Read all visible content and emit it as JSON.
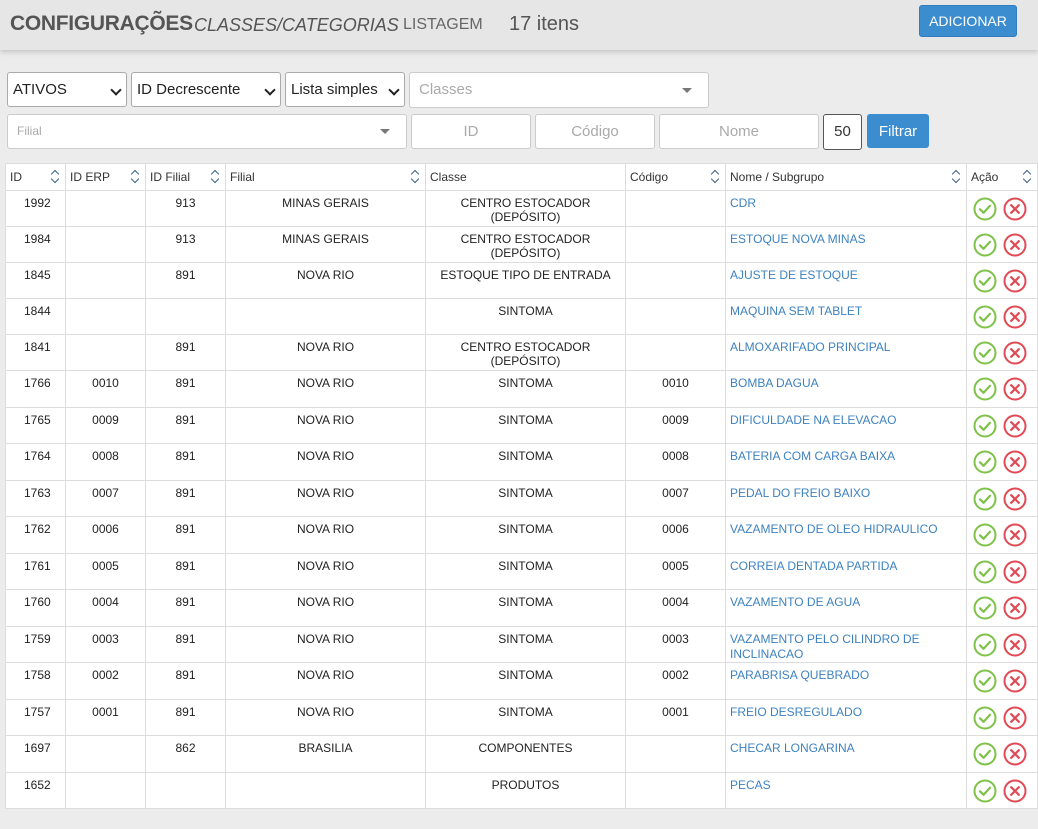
{
  "header": {
    "title": "CONFIGURAÇÕES",
    "subtitle": "CLASSES/CATEGORIAS",
    "view": "LISTAGEM",
    "count": "17 itens",
    "add_label": "ADICIONAR"
  },
  "filters": {
    "status": "ATIVOS",
    "order": "ID Decrescente",
    "mode": "Lista simples",
    "classes_placeholder": "Classes",
    "filial_placeholder": "Filial",
    "id_placeholder": "ID",
    "codigo_placeholder": "Código",
    "nome_placeholder": "Nome",
    "limit": "50",
    "filter_label": "Filtrar"
  },
  "table": {
    "columns": [
      "ID",
      "ID ERP",
      "ID Filial",
      "Filial",
      "Classe",
      "Código",
      "Nome / Subgrupo",
      "Ação"
    ],
    "rows": [
      {
        "id": "1992",
        "id_erp": "",
        "id_filial": "913",
        "filial": "MINAS GERAIS",
        "classe": "CENTRO ESTOCADOR (DEPÓSITO)",
        "codigo": "",
        "nome": "CDR"
      },
      {
        "id": "1984",
        "id_erp": "",
        "id_filial": "913",
        "filial": "MINAS GERAIS",
        "classe": "CENTRO ESTOCADOR (DEPÓSITO)",
        "codigo": "",
        "nome": "ESTOQUE NOVA MINAS"
      },
      {
        "id": "1845",
        "id_erp": "",
        "id_filial": "891",
        "filial": "NOVA RIO",
        "classe": "ESTOQUE TIPO DE ENTRADA",
        "codigo": "",
        "nome": "AJUSTE DE ESTOQUE"
      },
      {
        "id": "1844",
        "id_erp": "",
        "id_filial": "",
        "filial": "",
        "classe": "SINTOMA",
        "codigo": "",
        "nome": "MAQUINA SEM TABLET"
      },
      {
        "id": "1841",
        "id_erp": "",
        "id_filial": "891",
        "filial": "NOVA RIO",
        "classe": "CENTRO ESTOCADOR (DEPÓSITO)",
        "codigo": "",
        "nome": "ALMOXARIFADO PRINCIPAL"
      },
      {
        "id": "1766",
        "id_erp": "0010",
        "id_filial": "891",
        "filial": "NOVA RIO",
        "classe": "SINTOMA",
        "codigo": "0010",
        "nome": "BOMBA DAGUA"
      },
      {
        "id": "1765",
        "id_erp": "0009",
        "id_filial": "891",
        "filial": "NOVA RIO",
        "classe": "SINTOMA",
        "codigo": "0009",
        "nome": "DIFICULDADE NA ELEVACAO"
      },
      {
        "id": "1764",
        "id_erp": "0008",
        "id_filial": "891",
        "filial": "NOVA RIO",
        "classe": "SINTOMA",
        "codigo": "0008",
        "nome": "BATERIA COM CARGA BAIXA"
      },
      {
        "id": "1763",
        "id_erp": "0007",
        "id_filial": "891",
        "filial": "NOVA RIO",
        "classe": "SINTOMA",
        "codigo": "0007",
        "nome": "PEDAL DO FREIO BAIXO"
      },
      {
        "id": "1762",
        "id_erp": "0006",
        "id_filial": "891",
        "filial": "NOVA RIO",
        "classe": "SINTOMA",
        "codigo": "0006",
        "nome": "VAZAMENTO DE OLEO HIDRAULICO"
      },
      {
        "id": "1761",
        "id_erp": "0005",
        "id_filial": "891",
        "filial": "NOVA RIO",
        "classe": "SINTOMA",
        "codigo": "0005",
        "nome": "CORREIA DENTADA PARTIDA"
      },
      {
        "id": "1760",
        "id_erp": "0004",
        "id_filial": "891",
        "filial": "NOVA RIO",
        "classe": "SINTOMA",
        "codigo": "0004",
        "nome": "VAZAMENTO DE AGUA"
      },
      {
        "id": "1759",
        "id_erp": "0003",
        "id_filial": "891",
        "filial": "NOVA RIO",
        "classe": "SINTOMA",
        "codigo": "0003",
        "nome": "VAZAMENTO PELO CILINDRO DE INCLINACAO"
      },
      {
        "id": "1758",
        "id_erp": "0002",
        "id_filial": "891",
        "filial": "NOVA RIO",
        "classe": "SINTOMA",
        "codigo": "0002",
        "nome": "PARABRISA QUEBRADO"
      },
      {
        "id": "1757",
        "id_erp": "0001",
        "id_filial": "891",
        "filial": "NOVA RIO",
        "classe": "SINTOMA",
        "codigo": "0001",
        "nome": "FREIO DESREGULADO"
      },
      {
        "id": "1697",
        "id_erp": "",
        "id_filial": "862",
        "filial": "BRASILIA",
        "classe": "COMPONENTES",
        "codigo": "",
        "nome": "CHECAR LONGARINA"
      },
      {
        "id": "1652",
        "id_erp": "",
        "id_filial": "",
        "filial": "",
        "classe": "PRODUTOS",
        "codigo": "",
        "nome": "PECAS"
      }
    ],
    "actions": [
      "check-circle-icon",
      "x-circle-icon"
    ]
  },
  "colors": {
    "primary": "#3c8dcf",
    "link": "#3e82c0",
    "approve": "#7fc24a",
    "delete": "#e04a55"
  }
}
